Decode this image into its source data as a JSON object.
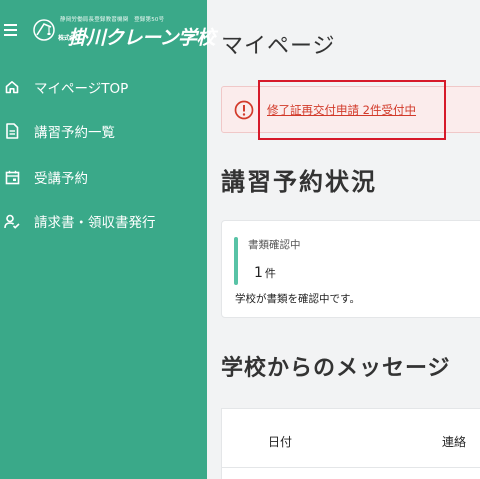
{
  "logo": {
    "small_text": "静岡労働局長登録教習機関　登録第50号",
    "tiny_text": "株式会社",
    "name": "掛川クレーン学校"
  },
  "sidebar": {
    "items": [
      {
        "label": "マイページTOP",
        "icon": "home-icon"
      },
      {
        "label": "講習予約一覧",
        "icon": "document-icon"
      },
      {
        "label": "受講予約",
        "icon": "calendar-icon"
      },
      {
        "label": "請求書・領収書発行",
        "icon": "user-check-icon"
      }
    ]
  },
  "page": {
    "title": "マイページ"
  },
  "alert": {
    "text": "修了証再交付申請 2件受付中",
    "color": "#d23a2a"
  },
  "reservation_status": {
    "title": "講習予約状況",
    "card": {
      "label": "書類確認中",
      "count": "1",
      "unit": "件",
      "description": "学校が書類を確認中です。"
    }
  },
  "messages": {
    "title": "学校からのメッセージ",
    "columns": [
      "日付",
      "連絡"
    ]
  },
  "colors": {
    "sidebar": "#3aa989",
    "accent": "#58c3a6",
    "highlight": "#d61a2a"
  }
}
